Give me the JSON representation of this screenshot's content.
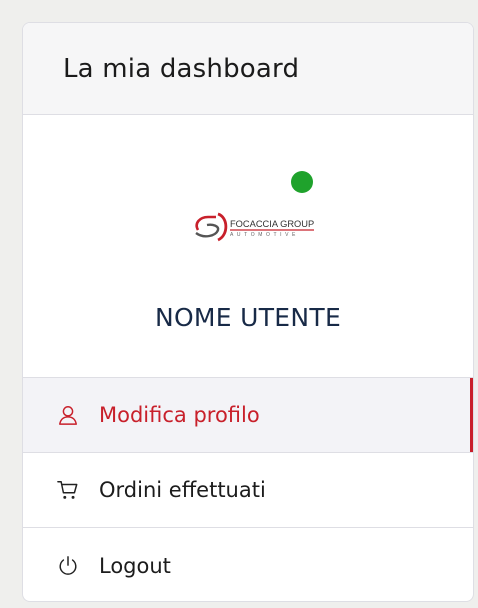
{
  "dashboard": {
    "title": "La mia dashboard"
  },
  "profile": {
    "logo_text_top": "FOCACCIA GROUP",
    "logo_text_bottom": "AUTOMOTIVE",
    "status_color": "#1fa22c",
    "user_name": "NOME UTENTE"
  },
  "menu": {
    "items": [
      {
        "label": "Modifica profilo",
        "icon": "user-icon",
        "active": true
      },
      {
        "label": "Ordini effettuati",
        "icon": "cart-icon",
        "active": false
      },
      {
        "label": "Logout",
        "icon": "power-icon",
        "active": false
      }
    ]
  },
  "colors": {
    "accent": "#c8202b",
    "name_text": "#182a47",
    "status_online": "#1fa22c"
  }
}
